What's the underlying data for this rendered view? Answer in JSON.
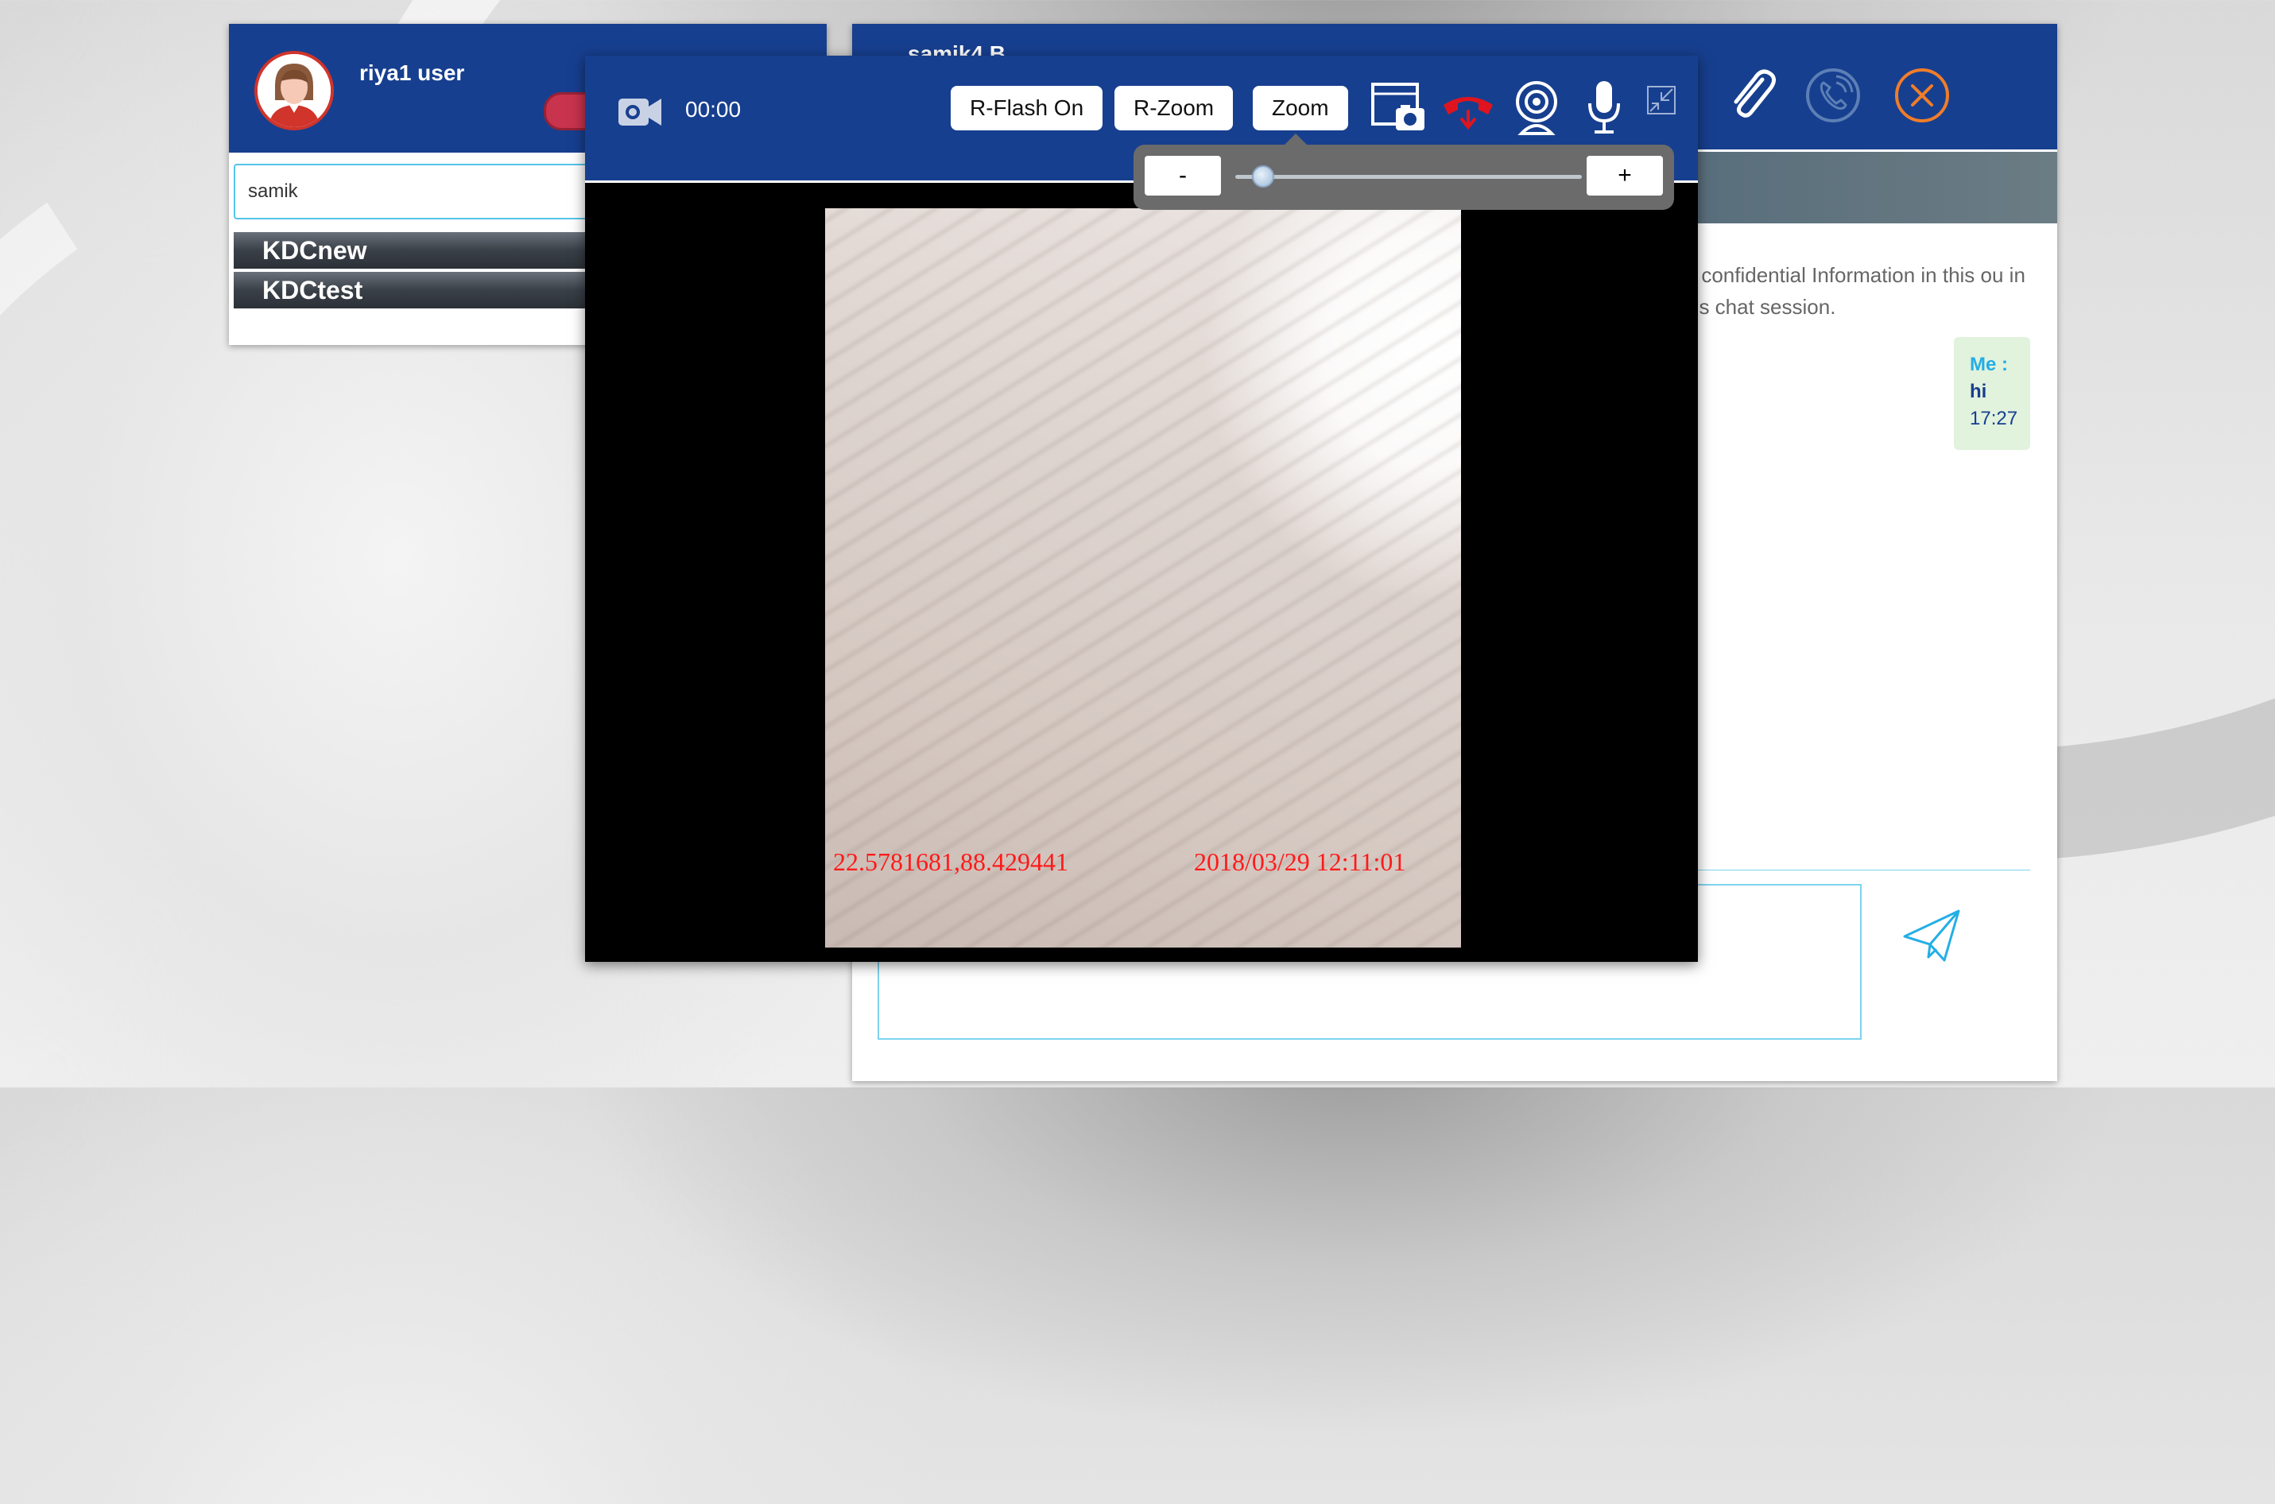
{
  "contacts_panel": {
    "user_name": "riya1 user",
    "search_value": "samik",
    "contacts": [
      {
        "label": "KDCnew"
      },
      {
        "label": "KDCtest"
      }
    ]
  },
  "chat_panel": {
    "title": "samik4 B",
    "disclaimer": "er confidential Information in this ou in this chat session.",
    "message": {
      "sender": "Me :",
      "text": "hi",
      "time": "17:27"
    }
  },
  "video_call": {
    "timer": "00:00",
    "buttons": {
      "flash": "R-Flash On",
      "rzoom": "R-Zoom",
      "zoom": "Zoom"
    },
    "zoom_slider": {
      "minus": "-",
      "plus": "+",
      "level": 0.08
    },
    "overlay": {
      "coords": "22.5781681,88.429441",
      "datetime": "2018/03/29 12:11:01"
    }
  },
  "colors": {
    "header_blue": "#173f8f",
    "end_call_red": "#e0141e",
    "close_orange": "#f07d2a",
    "accent_cyan": "#23aee6",
    "overlay_red": "#ff1a1a"
  },
  "icons": [
    "video-camera-icon",
    "screenshot-icon",
    "end-call-icon",
    "webcam-icon",
    "microphone-icon",
    "minimize-icon",
    "paperclip-icon",
    "phone-icon",
    "close-icon",
    "send-icon"
  ]
}
